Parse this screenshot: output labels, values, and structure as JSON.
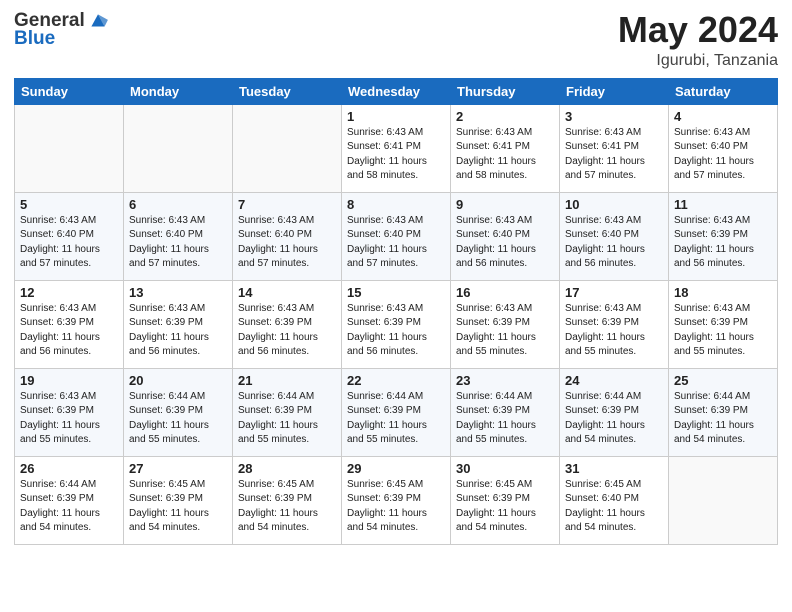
{
  "header": {
    "logo_line1": "General",
    "logo_line2": "Blue",
    "title": "May 2024",
    "location": "Igurubi, Tanzania"
  },
  "days_of_week": [
    "Sunday",
    "Monday",
    "Tuesday",
    "Wednesday",
    "Thursday",
    "Friday",
    "Saturday"
  ],
  "weeks": [
    [
      {
        "day": "",
        "sunrise": "",
        "sunset": "",
        "daylight": ""
      },
      {
        "day": "",
        "sunrise": "",
        "sunset": "",
        "daylight": ""
      },
      {
        "day": "",
        "sunrise": "",
        "sunset": "",
        "daylight": ""
      },
      {
        "day": "1",
        "sunrise": "Sunrise: 6:43 AM",
        "sunset": "Sunset: 6:41 PM",
        "daylight": "Daylight: 11 hours and 58 minutes."
      },
      {
        "day": "2",
        "sunrise": "Sunrise: 6:43 AM",
        "sunset": "Sunset: 6:41 PM",
        "daylight": "Daylight: 11 hours and 58 minutes."
      },
      {
        "day": "3",
        "sunrise": "Sunrise: 6:43 AM",
        "sunset": "Sunset: 6:41 PM",
        "daylight": "Daylight: 11 hours and 57 minutes."
      },
      {
        "day": "4",
        "sunrise": "Sunrise: 6:43 AM",
        "sunset": "Sunset: 6:40 PM",
        "daylight": "Daylight: 11 hours and 57 minutes."
      }
    ],
    [
      {
        "day": "5",
        "sunrise": "Sunrise: 6:43 AM",
        "sunset": "Sunset: 6:40 PM",
        "daylight": "Daylight: 11 hours and 57 minutes."
      },
      {
        "day": "6",
        "sunrise": "Sunrise: 6:43 AM",
        "sunset": "Sunset: 6:40 PM",
        "daylight": "Daylight: 11 hours and 57 minutes."
      },
      {
        "day": "7",
        "sunrise": "Sunrise: 6:43 AM",
        "sunset": "Sunset: 6:40 PM",
        "daylight": "Daylight: 11 hours and 57 minutes."
      },
      {
        "day": "8",
        "sunrise": "Sunrise: 6:43 AM",
        "sunset": "Sunset: 6:40 PM",
        "daylight": "Daylight: 11 hours and 57 minutes."
      },
      {
        "day": "9",
        "sunrise": "Sunrise: 6:43 AM",
        "sunset": "Sunset: 6:40 PM",
        "daylight": "Daylight: 11 hours and 56 minutes."
      },
      {
        "day": "10",
        "sunrise": "Sunrise: 6:43 AM",
        "sunset": "Sunset: 6:40 PM",
        "daylight": "Daylight: 11 hours and 56 minutes."
      },
      {
        "day": "11",
        "sunrise": "Sunrise: 6:43 AM",
        "sunset": "Sunset: 6:39 PM",
        "daylight": "Daylight: 11 hours and 56 minutes."
      }
    ],
    [
      {
        "day": "12",
        "sunrise": "Sunrise: 6:43 AM",
        "sunset": "Sunset: 6:39 PM",
        "daylight": "Daylight: 11 hours and 56 minutes."
      },
      {
        "day": "13",
        "sunrise": "Sunrise: 6:43 AM",
        "sunset": "Sunset: 6:39 PM",
        "daylight": "Daylight: 11 hours and 56 minutes."
      },
      {
        "day": "14",
        "sunrise": "Sunrise: 6:43 AM",
        "sunset": "Sunset: 6:39 PM",
        "daylight": "Daylight: 11 hours and 56 minutes."
      },
      {
        "day": "15",
        "sunrise": "Sunrise: 6:43 AM",
        "sunset": "Sunset: 6:39 PM",
        "daylight": "Daylight: 11 hours and 56 minutes."
      },
      {
        "day": "16",
        "sunrise": "Sunrise: 6:43 AM",
        "sunset": "Sunset: 6:39 PM",
        "daylight": "Daylight: 11 hours and 55 minutes."
      },
      {
        "day": "17",
        "sunrise": "Sunrise: 6:43 AM",
        "sunset": "Sunset: 6:39 PM",
        "daylight": "Daylight: 11 hours and 55 minutes."
      },
      {
        "day": "18",
        "sunrise": "Sunrise: 6:43 AM",
        "sunset": "Sunset: 6:39 PM",
        "daylight": "Daylight: 11 hours and 55 minutes."
      }
    ],
    [
      {
        "day": "19",
        "sunrise": "Sunrise: 6:43 AM",
        "sunset": "Sunset: 6:39 PM",
        "daylight": "Daylight: 11 hours and 55 minutes."
      },
      {
        "day": "20",
        "sunrise": "Sunrise: 6:44 AM",
        "sunset": "Sunset: 6:39 PM",
        "daylight": "Daylight: 11 hours and 55 minutes."
      },
      {
        "day": "21",
        "sunrise": "Sunrise: 6:44 AM",
        "sunset": "Sunset: 6:39 PM",
        "daylight": "Daylight: 11 hours and 55 minutes."
      },
      {
        "day": "22",
        "sunrise": "Sunrise: 6:44 AM",
        "sunset": "Sunset: 6:39 PM",
        "daylight": "Daylight: 11 hours and 55 minutes."
      },
      {
        "day": "23",
        "sunrise": "Sunrise: 6:44 AM",
        "sunset": "Sunset: 6:39 PM",
        "daylight": "Daylight: 11 hours and 55 minutes."
      },
      {
        "day": "24",
        "sunrise": "Sunrise: 6:44 AM",
        "sunset": "Sunset: 6:39 PM",
        "daylight": "Daylight: 11 hours and 54 minutes."
      },
      {
        "day": "25",
        "sunrise": "Sunrise: 6:44 AM",
        "sunset": "Sunset: 6:39 PM",
        "daylight": "Daylight: 11 hours and 54 minutes."
      }
    ],
    [
      {
        "day": "26",
        "sunrise": "Sunrise: 6:44 AM",
        "sunset": "Sunset: 6:39 PM",
        "daylight": "Daylight: 11 hours and 54 minutes."
      },
      {
        "day": "27",
        "sunrise": "Sunrise: 6:45 AM",
        "sunset": "Sunset: 6:39 PM",
        "daylight": "Daylight: 11 hours and 54 minutes."
      },
      {
        "day": "28",
        "sunrise": "Sunrise: 6:45 AM",
        "sunset": "Sunset: 6:39 PM",
        "daylight": "Daylight: 11 hours and 54 minutes."
      },
      {
        "day": "29",
        "sunrise": "Sunrise: 6:45 AM",
        "sunset": "Sunset: 6:39 PM",
        "daylight": "Daylight: 11 hours and 54 minutes."
      },
      {
        "day": "30",
        "sunrise": "Sunrise: 6:45 AM",
        "sunset": "Sunset: 6:39 PM",
        "daylight": "Daylight: 11 hours and 54 minutes."
      },
      {
        "day": "31",
        "sunrise": "Sunrise: 6:45 AM",
        "sunset": "Sunset: 6:40 PM",
        "daylight": "Daylight: 11 hours and 54 minutes."
      },
      {
        "day": "",
        "sunrise": "",
        "sunset": "",
        "daylight": ""
      }
    ]
  ]
}
